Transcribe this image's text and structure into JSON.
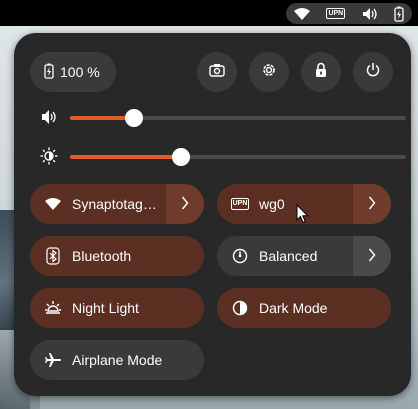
{
  "topbar": {
    "indicators": [
      {
        "icon": "wifi-icon"
      },
      {
        "icon": "vpn-icon",
        "label": "UPN"
      },
      {
        "icon": "volume-icon"
      },
      {
        "icon": "battery-charging-icon"
      }
    ]
  },
  "panel": {
    "battery": {
      "icon": "battery-charging-icon",
      "label": "100 %"
    },
    "actions": [
      {
        "icon": "screenshot-icon"
      },
      {
        "icon": "settings-icon"
      },
      {
        "icon": "lock-icon"
      },
      {
        "icon": "power-icon"
      }
    ],
    "sliders": [
      {
        "icon": "volume-icon",
        "level": 0.19
      },
      {
        "icon": "brightness-icon",
        "level": 0.33
      }
    ],
    "tiles": [
      {
        "label": "Synaptotag…",
        "icon": "wifi-icon",
        "active": true,
        "has_arrow": true
      },
      {
        "label": "wg0",
        "icon": "vpn-icon",
        "icon_text": "UPN",
        "active": true,
        "has_arrow": true
      },
      {
        "label": "Bluetooth",
        "icon": "bluetooth-icon",
        "active": true,
        "has_arrow": false
      },
      {
        "label": "Balanced",
        "icon": "power-profile-icon",
        "active": false,
        "has_arrow": true
      },
      {
        "label": "Night Light",
        "icon": "night-light-icon",
        "active": true,
        "has_arrow": false
      },
      {
        "label": "Dark Mode",
        "icon": "dark-mode-icon",
        "active": true,
        "has_arrow": false
      },
      {
        "label": "Airplane Mode",
        "icon": "airplane-icon",
        "active": false,
        "has_arrow": false
      }
    ]
  },
  "colors": {
    "accent": "#e35b2a",
    "tile_active": "#5b2f22",
    "tile_inactive": "#3a3a3a",
    "panel_bg": "#282828"
  }
}
